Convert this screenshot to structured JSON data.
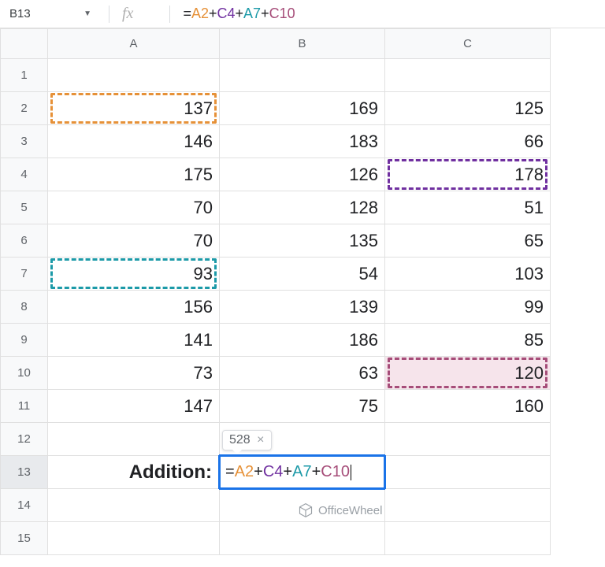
{
  "formula_bar": {
    "name_box": "B13",
    "fx_label": "fx",
    "formula": {
      "eq": "=",
      "r1": "A2",
      "op": "+",
      "r2": "C4",
      "r3": "A7",
      "r4": "C10"
    }
  },
  "columns": {
    "A": "A",
    "B": "B",
    "C": "C"
  },
  "rows": [
    "1",
    "2",
    "3",
    "4",
    "5",
    "6",
    "7",
    "8",
    "9",
    "10",
    "11",
    "12",
    "13",
    "14",
    "15"
  ],
  "grid": {
    "A": {
      "2": "137",
      "3": "146",
      "4": "175",
      "5": "70",
      "6": "70",
      "7": "93",
      "8": "156",
      "9": "141",
      "10": "73",
      "11": "147",
      "13": "Addition:"
    },
    "B": {
      "2": "169",
      "3": "183",
      "4": "126",
      "5": "128",
      "6": "135",
      "7": "54",
      "8": "139",
      "9": "186",
      "10": "63",
      "11": "75"
    },
    "C": {
      "2": "125",
      "3": "66",
      "4": "178",
      "5": "51",
      "6": "65",
      "7": "103",
      "8": "99",
      "9": "85",
      "10": "120",
      "11": "160"
    }
  },
  "editing": {
    "cell": "B13",
    "tooltip_value": "528",
    "tooltip_close": "×",
    "formula_parts": {
      "eq": "=",
      "r1": "A2",
      "op": "+",
      "r2": "C4",
      "r3": "A7",
      "r4": "C10"
    }
  },
  "highlights": {
    "A2": "orange",
    "C4": "purple",
    "A7": "teal",
    "C10": "maroon"
  },
  "watermark": "OfficeWheel"
}
